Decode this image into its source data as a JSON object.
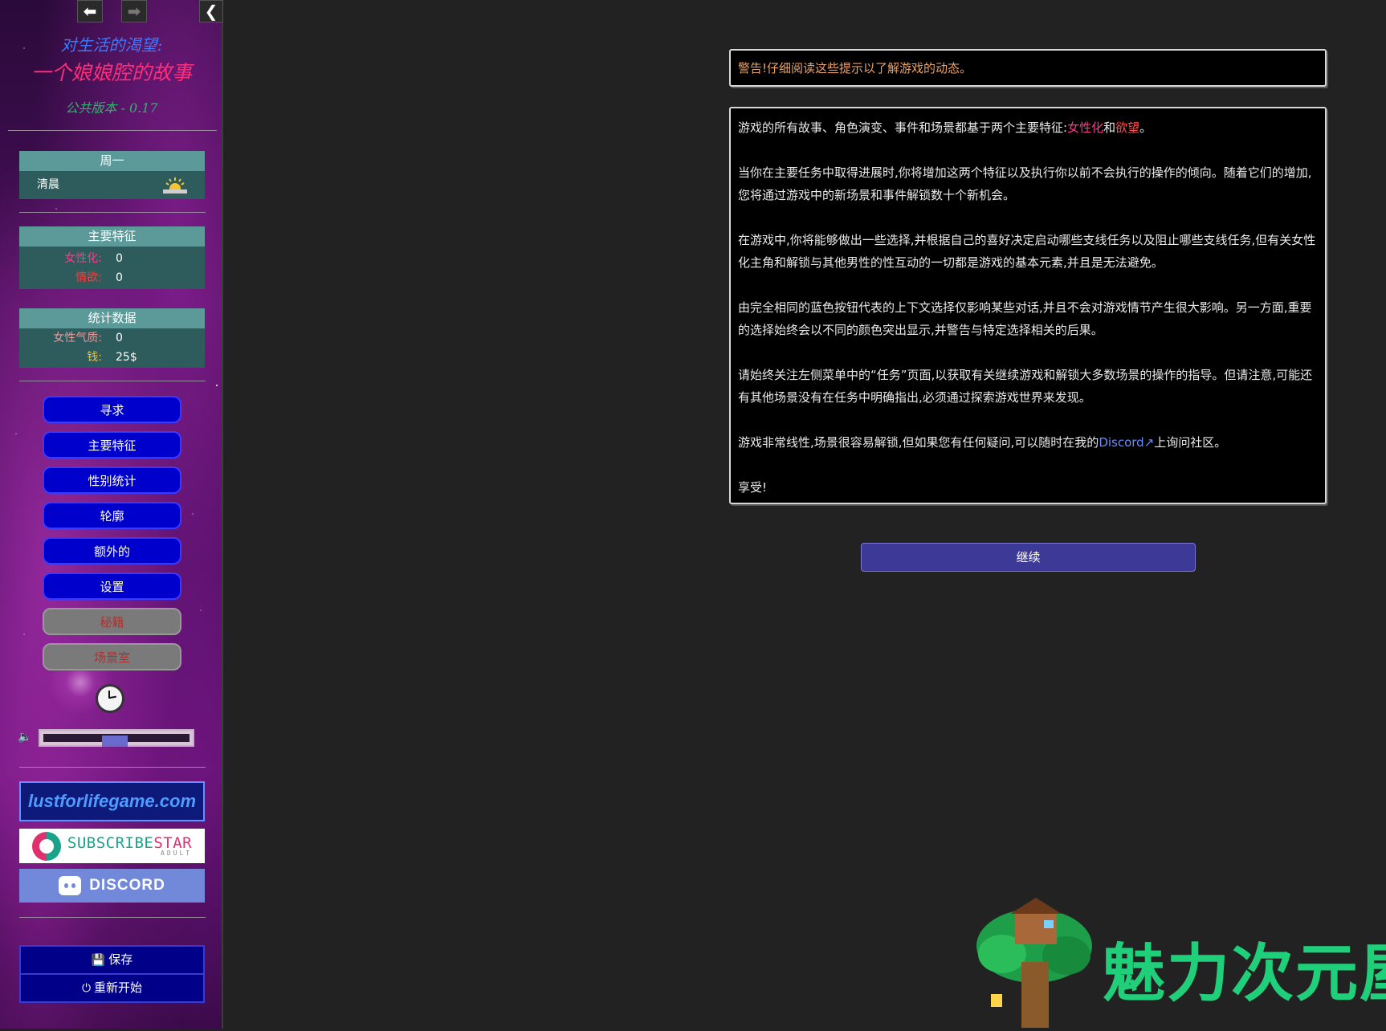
{
  "nav": {
    "back_icon": "arrow-left-icon",
    "forward_icon": "arrow-right-icon",
    "collapse_icon": "chevron-left-icon"
  },
  "game": {
    "title_line1": "对生活的渴望:",
    "title_line2": "一个娘娘腔的故事",
    "version": "公共版本 - 0.17"
  },
  "time": {
    "day": "周一",
    "period": "清晨",
    "period_icon": "sunrise-icon"
  },
  "main_traits": {
    "header": "主要特征",
    "items": [
      {
        "label": "女性化:",
        "value": "0",
        "color": "#ff3a8a"
      },
      {
        "label": "情欲:",
        "value": "0",
        "color": "#ff3a3a"
      }
    ]
  },
  "stats": {
    "header": "统计数据",
    "items": [
      {
        "label": "女性气质:",
        "value": "0",
        "color": "#e89a9a"
      },
      {
        "label": "钱:",
        "value": "25$",
        "color": "#f0c040"
      }
    ]
  },
  "menu": {
    "items": [
      {
        "label": "寻求",
        "enabled": true
      },
      {
        "label": "主要特征",
        "enabled": true
      },
      {
        "label": "性别统计",
        "enabled": true
      },
      {
        "label": "轮廓",
        "enabled": true
      },
      {
        "label": "额外的",
        "enabled": true
      },
      {
        "label": "设置",
        "enabled": true
      },
      {
        "label": "秘籍",
        "enabled": false
      },
      {
        "label": "场景室",
        "enabled": false
      }
    ]
  },
  "volume": {
    "level": 0.5,
    "icon": "speaker-icon"
  },
  "banners": {
    "site": "lustforlifegame.com",
    "subscribestar": {
      "subscribe": "SUBSCRIBE",
      "star": "STAR",
      "sub": "ADULT"
    },
    "discord": "DISCORD"
  },
  "bottom": {
    "save": "保存",
    "restart": "重新开始",
    "save_icon": "floppy-icon",
    "restart_icon": "power-icon"
  },
  "content": {
    "warning": "警告!仔细阅读这些提示以了解游戏的动态。",
    "p1_prefix": "游戏的所有故事、角色演变、事件和场景都基于两个主要特征:",
    "p1_trait1": "女性化",
    "p1_and": "和",
    "p1_trait2": "欲望",
    "p1_suffix": "。",
    "p2": "当你在主要任务中取得进展时,你将增加这两个特征以及执行你以前不会执行的操作的倾向。随着它们的增加,您将通过游戏中的新场景和事件解锁数十个新机会。",
    "p3": "在游戏中,你将能够做出一些选择,并根据自己的喜好决定启动哪些支线任务以及阻止哪些支线任务,但有关女性化主角和解锁与其他男性的性互动的一切都是游戏的基本元素,并且是无法避免。",
    "p4": "由完全相同的蓝色按钮代表的上下文选择仅影响某些对话,并且不会对游戏情节产生很大影响。另一方面,重要的选择始终会以不同的颜色突出显示,并警告与特定选择相关的后果。",
    "p5": "请始终关注左侧菜单中的“任务”页面,以获取有关继续游戏和解锁大多数场景的操作的指导。但请注意,可能还有其他场景没有在任务中明确指出,必须通过探索游戏世界来发现。",
    "p6_prefix": "游戏非常线性,场景很容易解锁,但如果您有任何疑问,可以随时在我的",
    "p6_link": "Discord",
    "p6_suffix": "上询问社区。",
    "p7": "享受!",
    "continue": "继续"
  },
  "watermark": {
    "text": "魅力次元屋",
    "icon": "treehouse-icon"
  }
}
